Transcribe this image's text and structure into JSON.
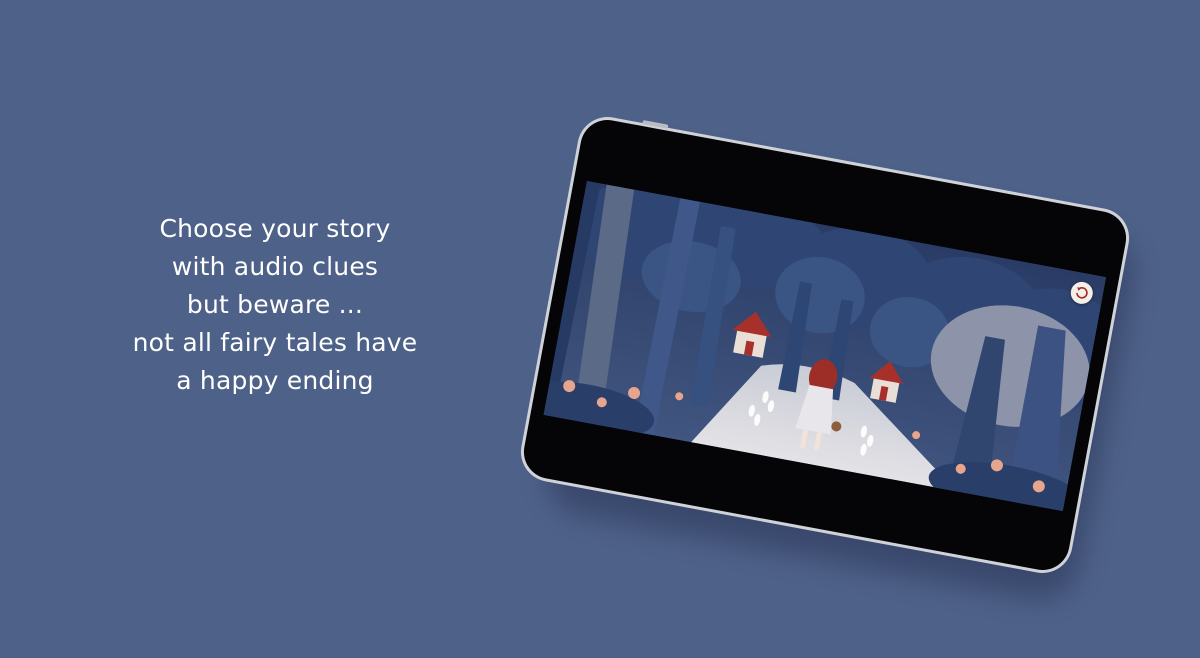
{
  "tagline": {
    "line1": "Choose your story",
    "line2": "with audio clues",
    "line3": "but beware ...",
    "line4": "not all fairy tales have",
    "line5": "a happy ending"
  },
  "game_scene": {
    "restart_icon": "restart-arrow-icon",
    "character": "red-riding-hood",
    "clue_icon": "footprints-icon"
  },
  "colors": {
    "background": "#4e6189",
    "text": "#ffffff",
    "accent": "#a8302a"
  }
}
